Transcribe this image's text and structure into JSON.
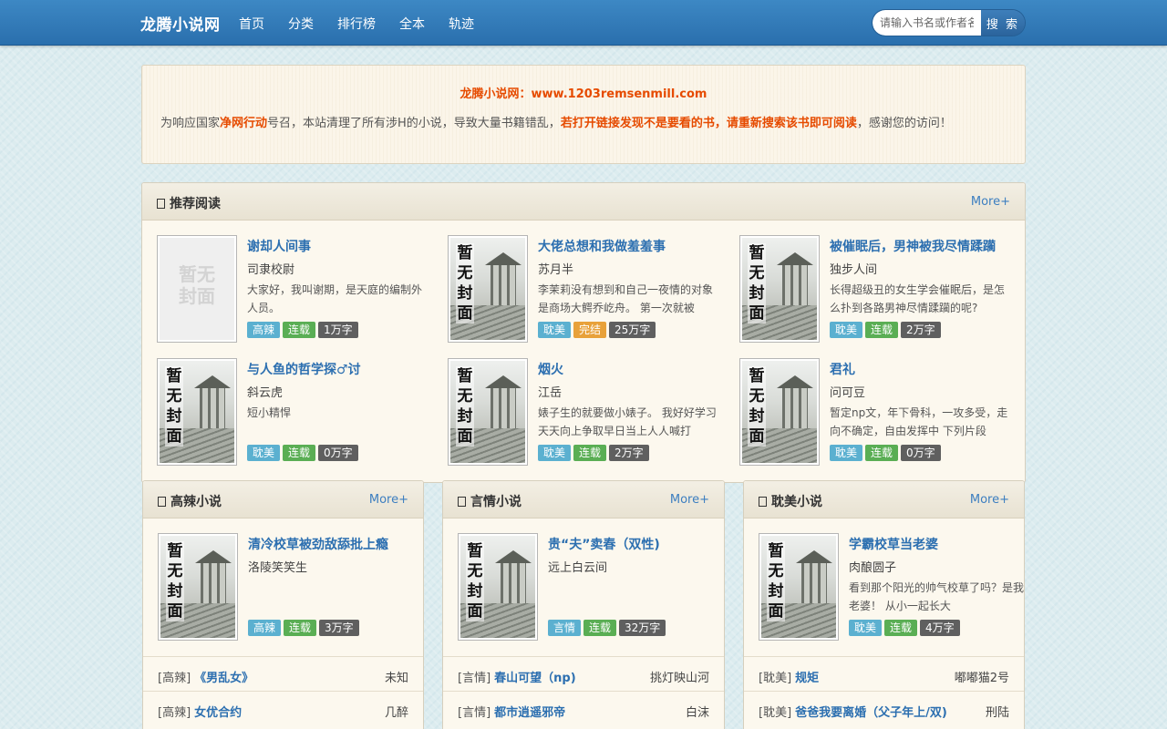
{
  "nav": {
    "brand": "龙腾小说网",
    "links": [
      "首页",
      "分类",
      "排行榜",
      "全本",
      "轨迹"
    ],
    "search_placeholder": "请输入书名或作者名",
    "search_button": "搜 索"
  },
  "notice": {
    "site": "龙腾小说网：www.1203remsenmill.com",
    "text_1": "为响应国家",
    "text_hl1": "净网行动",
    "text_2": "号召，本站清理了所有涉H的小说，导致大量书籍错乱，",
    "text_hl2": "若打开链接发现不是要看的书，请重新搜索该书即可阅读",
    "text_3": "，感谢您的访问！"
  },
  "recommend": {
    "title": "推荐阅读",
    "more": "More+",
    "books": [
      {
        "title": "谢却人间事",
        "author": "司隶校尉",
        "desc": "大家好，我叫谢期，是天庭的编制外人员。",
        "cat": "高辣",
        "status": "连载",
        "words": "1万字",
        "cover": "blank"
      },
      {
        "title": "大佬总想和我做羞羞事",
        "author": "苏月半",
        "desc": "李茉莉没有想到和自己一夜情的对象是商场大鳄乔屹舟。 第一次就被",
        "cat": "耽美",
        "status": "完结",
        "words": "25万字",
        "cover": "default"
      },
      {
        "title": "被催眠后，男神被我尽情蹂躏",
        "author": "独步人间",
        "desc": "长得超级丑的女生学会催眠后，是怎么扑到各路男神尽情蹂躏的呢?",
        "cat": "耽美",
        "status": "连载",
        "words": "2万字",
        "cover": "default"
      },
      {
        "title": "与人鱼的哲学探♂讨",
        "author": "斜云虎",
        "desc": "短小精悍",
        "cat": "耽美",
        "status": "连载",
        "words": "0万字",
        "cover": "default"
      },
      {
        "title": "烟火",
        "author": "江岳",
        "desc": "婊子生的就要做小婊子。 我好好学习天天向上争取早日当上人人喊打",
        "cat": "耽美",
        "status": "连载",
        "words": "2万字",
        "cover": "default"
      },
      {
        "title": "君礼",
        "author": "问可豆",
        "desc": "暂定np文，年下骨科，一攻多受，走向不确定，自由发挥中 下列片段",
        "cat": "耽美",
        "status": "连载",
        "words": "0万字",
        "cover": "default"
      }
    ]
  },
  "cover_text": {
    "default": [
      "暂",
      "无",
      "封",
      "面"
    ],
    "blank": "暂无\n封面"
  },
  "sections": [
    {
      "title": "高辣小说",
      "more": "More+",
      "book": {
        "title": "清冷校草被劲敌舔批上瘾",
        "author": "洛陵笑笑生",
        "desc": "",
        "cat": "高辣",
        "status": "连载",
        "words": "3万字"
      },
      "rows": [
        {
          "cat": "[高辣]",
          "title": "《男乱女》",
          "author": "未知"
        },
        {
          "cat": "[高辣]",
          "title": "女优合约",
          "author": "几醉"
        }
      ]
    },
    {
      "title": "言情小说",
      "more": "More+",
      "book": {
        "title": "贵“夫”卖春（双性)",
        "author": "远上白云间",
        "desc": "",
        "cat": "言情",
        "status": "连载",
        "words": "32万字"
      },
      "rows": [
        {
          "cat": "[言情]",
          "title": "春山可望（np)",
          "author": "挑灯映山河"
        },
        {
          "cat": "[言情]",
          "title": "都市逍遥邪帝",
          "author": "白沫"
        }
      ]
    },
    {
      "title": "耽美小说",
      "more": "More+",
      "book": {
        "title": "学霸校草当老婆",
        "author": "肉酿圆子",
        "desc": "看到那个阳光的帅气校草了吗？是我老婆！ 从小一起长大",
        "cat": "耽美",
        "status": "连载",
        "words": "4万字"
      },
      "rows": [
        {
          "cat": "[耽美]",
          "title": "规矩",
          "author": "嘟嘟猫2号"
        },
        {
          "cat": "[耽美]",
          "title": "爸爸我要离婚（父子年上/双)",
          "author": "刑陆"
        }
      ]
    }
  ],
  "colors": {
    "nav": "#2f78b6",
    "accent": "#e64b00",
    "link": "#2c6fb0"
  }
}
